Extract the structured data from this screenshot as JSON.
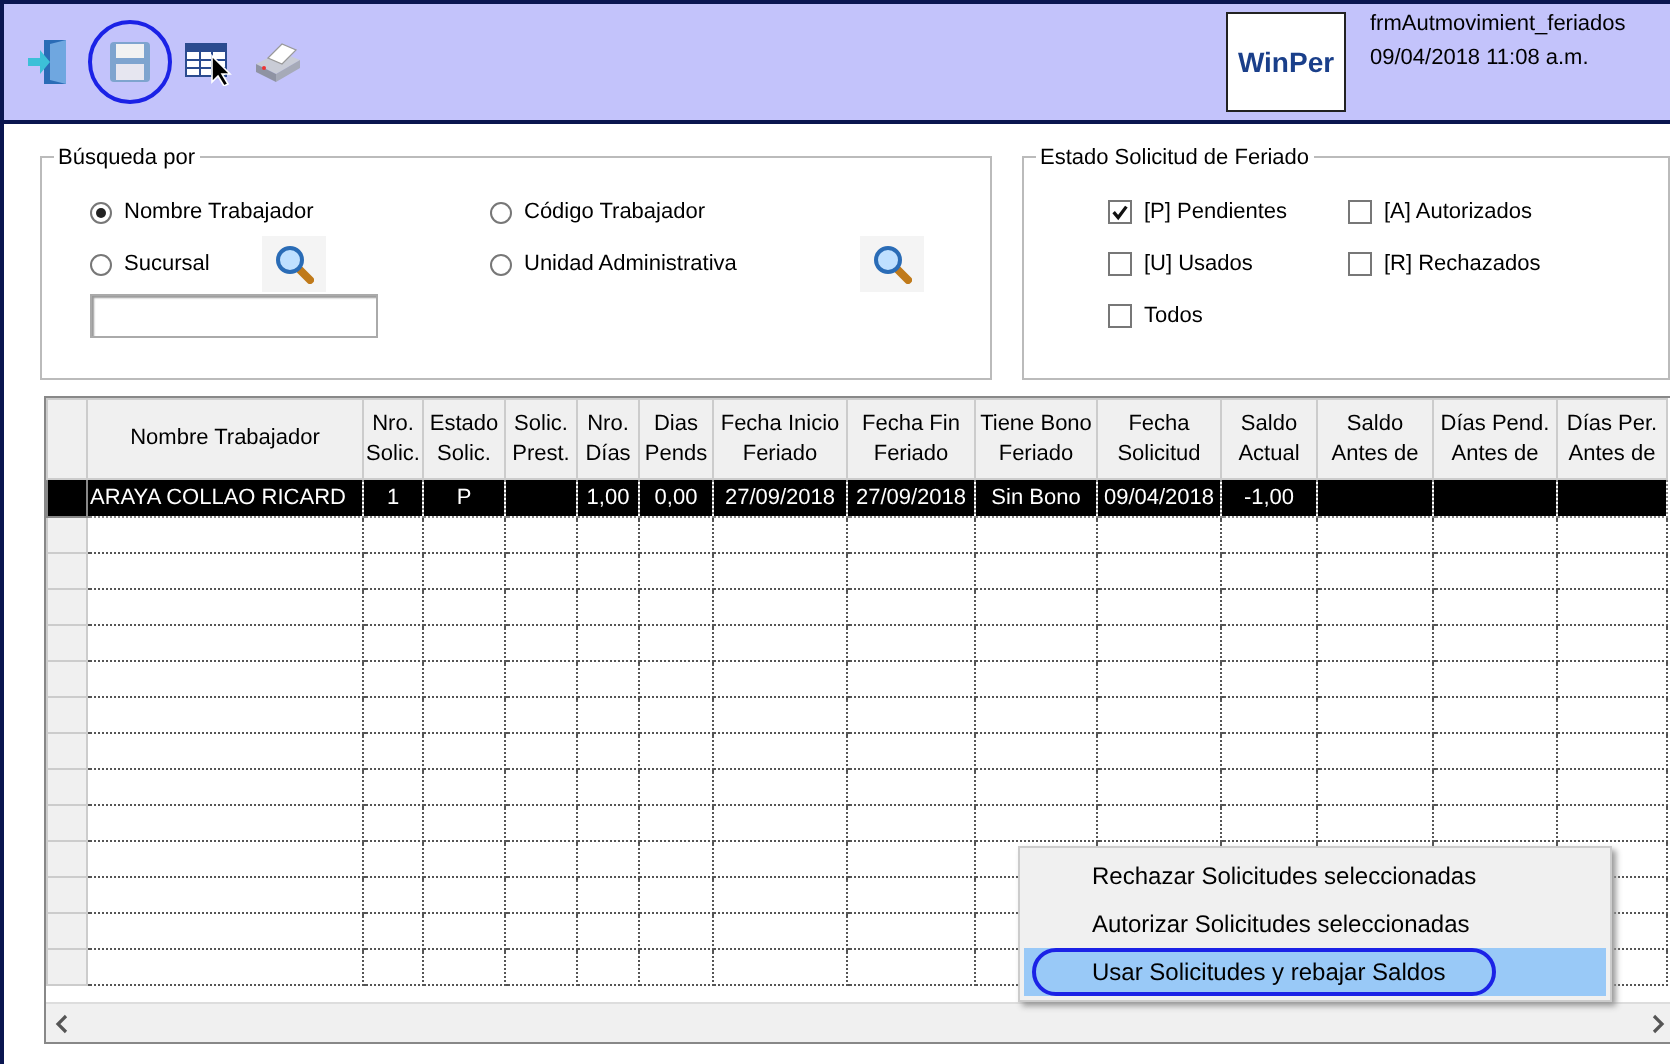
{
  "toolbar": {
    "buttons": [
      {
        "kind": "exit",
        "circled": false
      },
      {
        "kind": "save",
        "circled": true
      },
      {
        "kind": "grid",
        "circled": false
      },
      {
        "kind": "print",
        "circled": false
      }
    ]
  },
  "logo": {
    "left": "Win",
    "right": "Per"
  },
  "form": {
    "name": "frmAutmovimient_feriados",
    "datetime": "09/04/2018 11:08 a.m."
  },
  "search_group": {
    "title": "Búsqueda por",
    "options": [
      {
        "label": "Nombre Trabajador",
        "selected": true,
        "lookup": false
      },
      {
        "label": "Código Trabajador",
        "selected": false,
        "lookup": false
      },
      {
        "label": "Sucursal",
        "selected": false,
        "lookup": true
      },
      {
        "label": "Unidad Administrativa",
        "selected": false,
        "lookup": true
      }
    ]
  },
  "status_group": {
    "title": "Estado Solicitud de Feriado",
    "options": [
      {
        "label": "[P] Pendientes",
        "checked": true
      },
      {
        "label": "[A] Autorizados",
        "checked": false
      },
      {
        "label": "[U] Usados",
        "checked": false
      },
      {
        "label": "[R] Rechazados",
        "checked": false
      },
      {
        "label": "Todos",
        "checked": false
      }
    ]
  },
  "table": {
    "columns": [
      "Nombre Trabajador",
      "Nro. Solic.",
      "Estado Solic.",
      "Solic. Prest.",
      "Nro. Días",
      "Dias Pends",
      "Fecha Inicio Feriado",
      "Fecha Fin Feriado",
      "Tiene Bono Feriado",
      "Fecha Solicitud",
      "Saldo Actual",
      "Saldo Antes de",
      "Días Pend. Antes de",
      "Días Per. Antes de"
    ],
    "rows": [
      {
        "selected": true,
        "cells": [
          "ARAYA COLLAO RICARD",
          "1",
          "P",
          "",
          "1,00",
          "0,00",
          "27/09/2018",
          "27/09/2018",
          "Sin Bono",
          "09/04/2018",
          "-1,00",
          "",
          "",
          ""
        ]
      }
    ]
  },
  "context_menu": {
    "items": [
      {
        "label": "Rechazar Solicitudes seleccionadas",
        "selected": false,
        "circled": false
      },
      {
        "label": "Autorizar Solicitudes seleccionadas",
        "selected": false,
        "circled": false
      },
      {
        "label": "Usar Solicitudes y rebajar Saldos",
        "selected": true,
        "circled": true
      }
    ]
  }
}
